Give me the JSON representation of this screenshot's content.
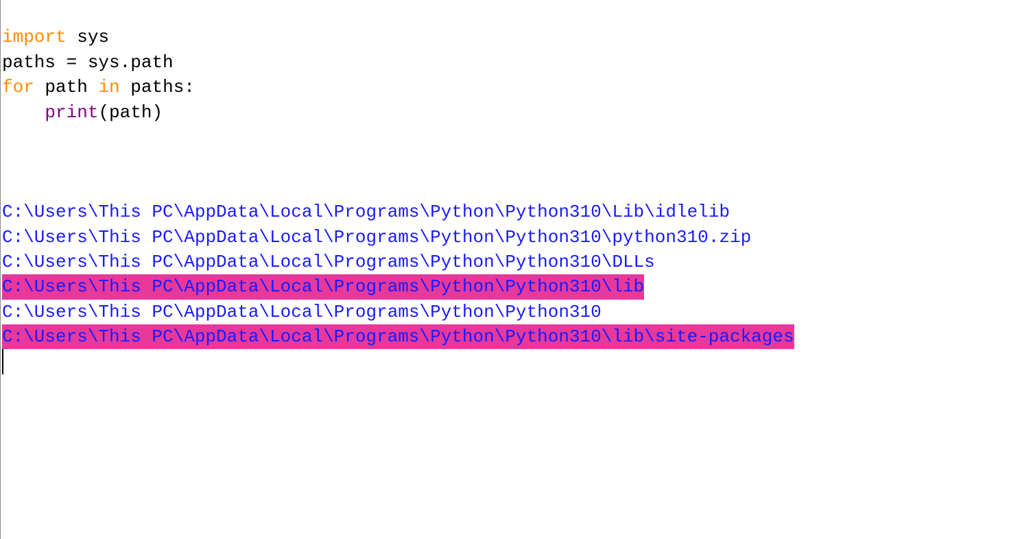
{
  "code": {
    "line1": {
      "kw_import": "import",
      "space1": " ",
      "module": "sys"
    },
    "line2": {
      "var": "paths",
      "eq": " = ",
      "expr": "sys.path"
    },
    "line3": {
      "kw_for": "for",
      "space1": " ",
      "var": "path",
      "space2": " ",
      "kw_in": "in",
      "space3": " ",
      "iter": "paths:"
    },
    "line4": {
      "indent": "    ",
      "func": "print",
      "paren_open": "(",
      "arg": "path",
      "paren_close": ")"
    }
  },
  "output": {
    "paths": [
      "C:\\Users\\This PC\\AppData\\Local\\Programs\\Python\\Python310\\Lib\\idlelib",
      "C:\\Users\\This PC\\AppData\\Local\\Programs\\Python\\Python310\\python310.zip",
      "C:\\Users\\This PC\\AppData\\Local\\Programs\\Python\\Python310\\DLLs",
      "C:\\Users\\This PC\\AppData\\Local\\Programs\\Python\\Python310\\lib",
      "C:\\Users\\This PC\\AppData\\Local\\Programs\\Python\\Python310",
      "C:\\Users\\This PC\\AppData\\Local\\Programs\\Python\\Python310\\lib\\site-packages"
    ],
    "highlighted_indices": [
      3,
      5
    ]
  }
}
